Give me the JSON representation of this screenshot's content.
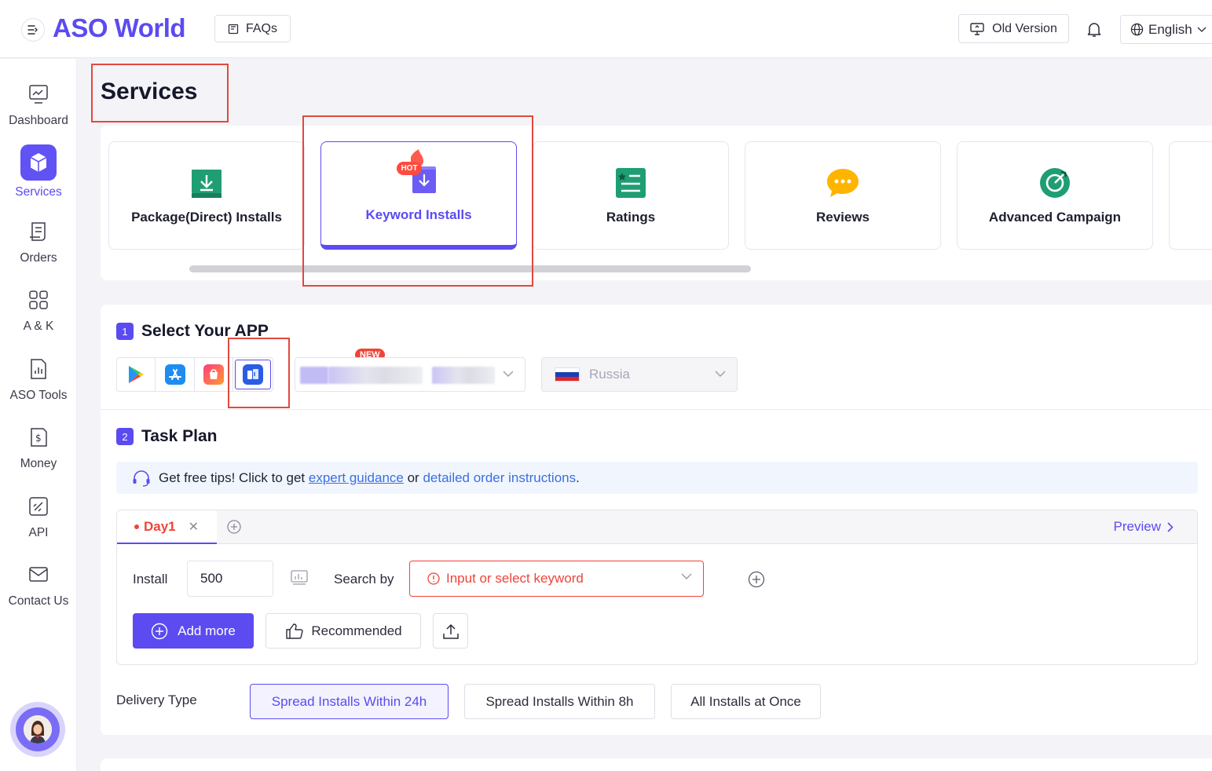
{
  "header": {
    "logo_text": "ASO World",
    "faq_label": "FAQs",
    "old_version_label": "Old Version",
    "language_label": "English"
  },
  "sidebar": {
    "items": [
      {
        "label": "Dashboard",
        "icon": "dashboard-icon"
      },
      {
        "label": "Services",
        "icon": "services-cube-icon",
        "active": true
      },
      {
        "label": "Orders",
        "icon": "orders-icon"
      },
      {
        "label": "A & K",
        "icon": "grid-icon"
      },
      {
        "label": "ASO Tools",
        "icon": "aso-tools-icon"
      },
      {
        "label": "Money",
        "icon": "money-icon"
      },
      {
        "label": "API",
        "icon": "api-icon"
      },
      {
        "label": "Contact Us",
        "icon": "mail-icon"
      }
    ]
  },
  "page_title": "Services",
  "services": [
    {
      "label": "Package(Direct) Installs",
      "icon": "download-box-icon"
    },
    {
      "label": "Keyword Installs",
      "icon": "keyword-download-icon",
      "badge": "HOT",
      "active": true
    },
    {
      "label": "Ratings",
      "icon": "ratings-list-icon"
    },
    {
      "label": "Reviews",
      "icon": "reviews-chat-icon"
    },
    {
      "label": "Advanced Campaign",
      "icon": "target-icon"
    }
  ],
  "step1": {
    "number": "1",
    "title": "Select Your APP",
    "new_badge": "NEW"
  },
  "stores": [
    "google-play-icon",
    "app-store-icon",
    "shop-bag-icon",
    "app-gallery-icon"
  ],
  "country": "Russia",
  "step2": {
    "number": "2",
    "title": "Task Plan"
  },
  "tip": {
    "prefix": "Get free tips! Click to get",
    "link1": "expert guidance",
    "middle": "or",
    "link2": "detailed order instructions",
    "suffix": "."
  },
  "plan": {
    "day_tab": "Day1",
    "preview_label": "Preview",
    "install_label": "Install",
    "install_value": "500",
    "search_by_label": "Search by",
    "keyword_placeholder": "Input or select keyword",
    "add_more_label": "Add more",
    "recommended_label": "Recommended"
  },
  "delivery": {
    "label": "Delivery Type",
    "options": [
      "Spread Installs Within 24h",
      "Spread Installs Within 8h",
      "All Installs at Once"
    ],
    "selected": "Spread Installs Within 24h"
  },
  "colors": {
    "accent": "#5b4bf0",
    "error": "#f04438",
    "link": "#3a6fe0",
    "annotation": "#e2483d"
  }
}
